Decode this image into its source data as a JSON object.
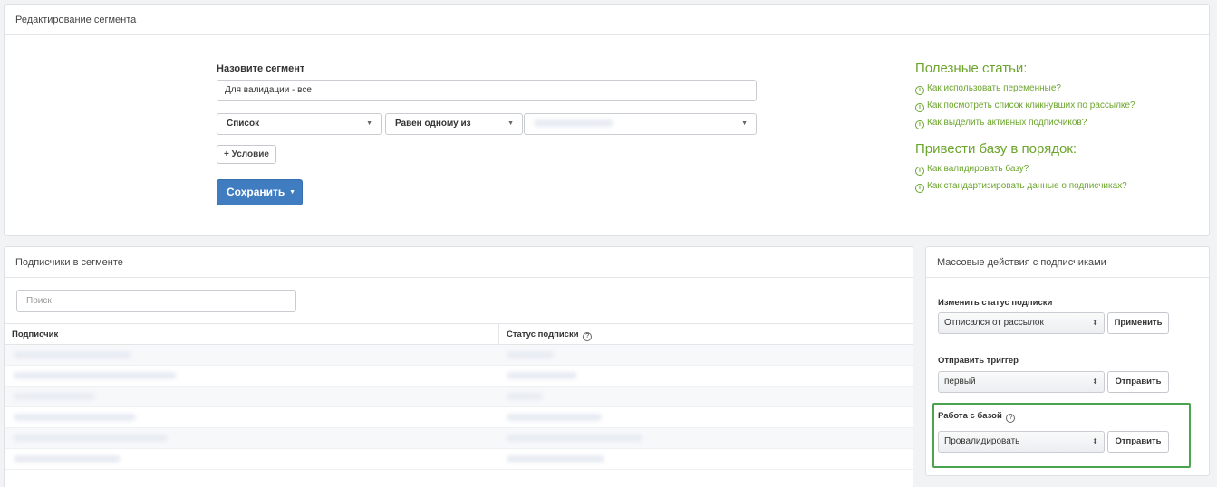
{
  "edit_panel": {
    "title": "Редактирование сегмента",
    "segment_label": "Назовите сегмент",
    "segment_value": "Для валидации - все",
    "condition": {
      "field": "Список",
      "operator": "Равен одному из"
    },
    "add_condition_label": "+ Условие",
    "save_label": "Сохранить"
  },
  "articles": {
    "heading1": "Полезные статьи:",
    "links1": [
      "Как использовать переменные?",
      "Как посмотреть список кликнувших по рассылке?",
      "Как выделить активных подписчиков?"
    ],
    "heading2": "Привести базу в порядок:",
    "links2": [
      "Как валидировать базу?",
      "Как стандартизировать данные о подписчиках?"
    ]
  },
  "subscribers": {
    "title": "Подписчики в сегменте",
    "search_placeholder": "Поиск",
    "col_subscriber": "Подписчик",
    "col_status": "Статус подписки"
  },
  "mass_actions": {
    "title": "Массовые действия с подписчиками",
    "status_label": "Изменить статус подписки",
    "status_value": "Отписался от рассылок",
    "apply_label": "Применить",
    "trigger_label": "Отправить триггер",
    "trigger_value": "первый",
    "send_label": "Отправить",
    "base_label": "Работа с базой",
    "base_value": "Провалидировать",
    "base_send_label": "Отправить"
  },
  "colors": {
    "link_green": "#6ca52d",
    "primary_blue": "#3f7cc0",
    "highlight_green": "#4aa34e"
  }
}
